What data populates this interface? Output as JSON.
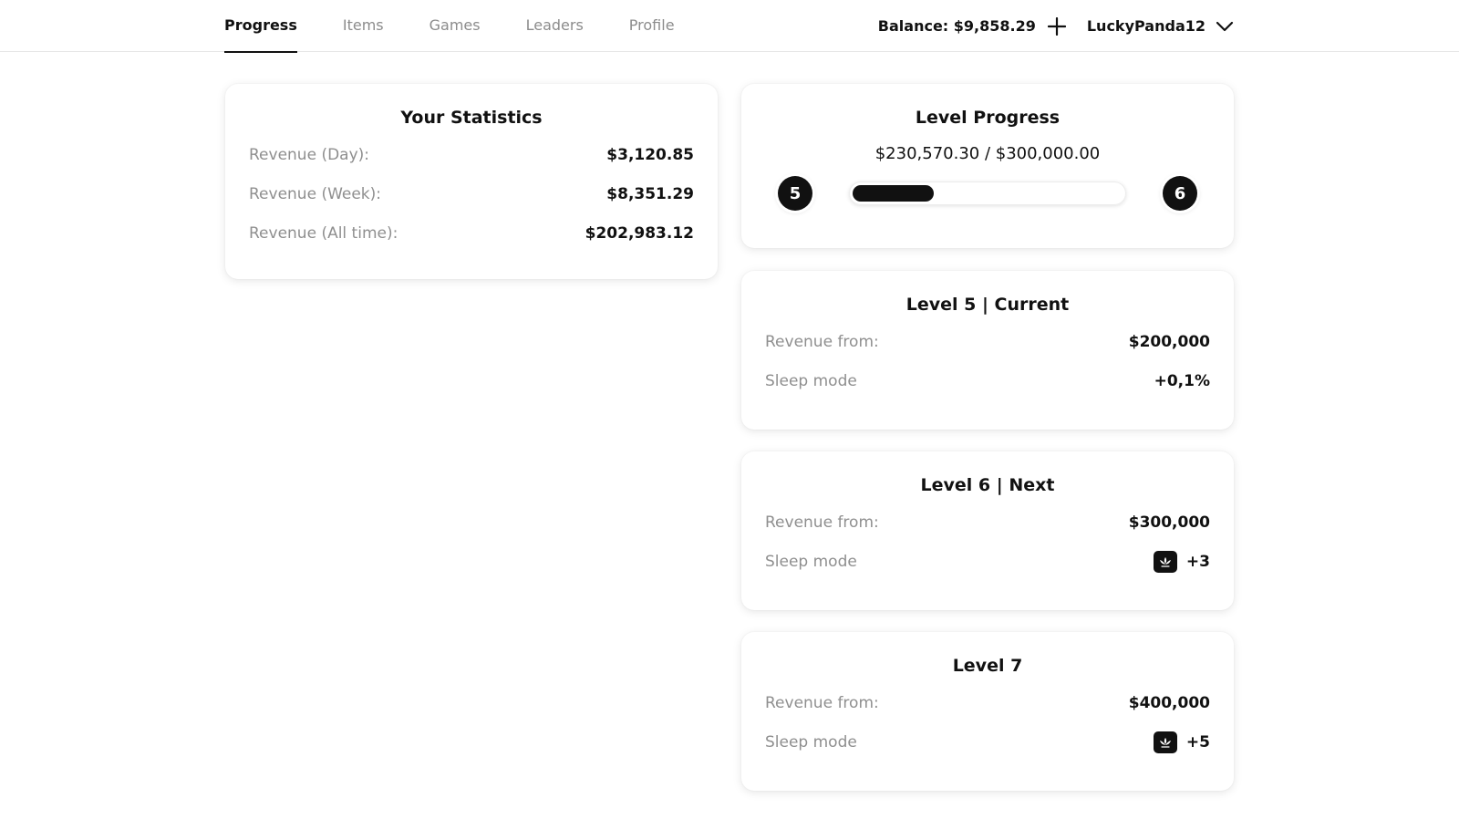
{
  "nav": {
    "tabs": [
      {
        "label": "Progress",
        "active": true
      },
      {
        "label": "Items",
        "active": false
      },
      {
        "label": "Games",
        "active": false
      },
      {
        "label": "Leaders",
        "active": false
      },
      {
        "label": "Profile",
        "active": false
      }
    ]
  },
  "header": {
    "balance": "Balance: $9,858.29",
    "username": "LuckyPanda12",
    "icons": {
      "add": "plus-icon",
      "menu": "chevron-down-icon"
    }
  },
  "stats": {
    "title": "Your Statistics",
    "rows": [
      {
        "label": "Revenue (Day):",
        "value": "$3,120.85"
      },
      {
        "label": "Revenue (Week):",
        "value": "$8,351.29"
      },
      {
        "label": "Revenue (All time):",
        "value": "$202,983.12"
      }
    ]
  },
  "progress": {
    "title": "Level Progress",
    "amount": "$230,570.30 / $300,000.00",
    "current_level": "5",
    "next_level": "6",
    "fill_fraction": 0.3
  },
  "levels": [
    {
      "title": "Level 5 | Current",
      "revenue_label": "Revenue from:",
      "revenue_value": "$200,000",
      "sleep_label": "Sleep mode",
      "sleep_value": "+0,1%",
      "sleep_icon": null
    },
    {
      "title": "Level 6 | Next",
      "revenue_label": "Revenue from:",
      "revenue_value": "$300,000",
      "sleep_label": "Sleep mode",
      "sleep_value": "+3",
      "sleep_icon": "lotus-icon"
    },
    {
      "title": "Level 7",
      "revenue_label": "Revenue from:",
      "revenue_value": "$400,000",
      "sleep_label": "Sleep mode",
      "sleep_value": "+5",
      "sleep_icon": "lotus-icon"
    }
  ],
  "colors": {
    "accent": "#111111",
    "muted_text": "#8f8f8f"
  }
}
